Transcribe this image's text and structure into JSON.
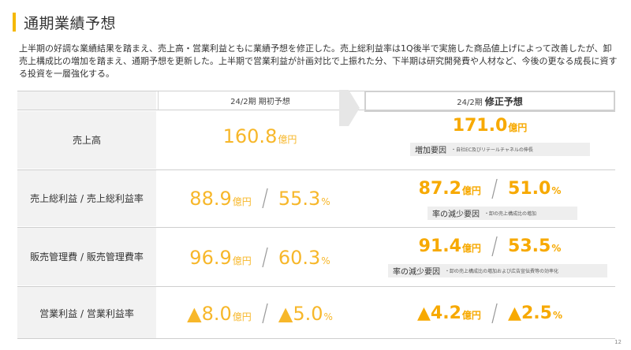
{
  "title": "通期業績予想",
  "description": "上半期の好調な業績結果を踏まえ、売上高・営業利益ともに業績予想を修正した。売上総利益率は1Q後半で実施した商品値上げによって改善したが、卸売上構成比の増加を踏まえ、通期予想を更新した。上半期で営業利益が計画対比で上振れた分、下半期は研究開発費や人材など、今後の更なる成長に資する投資を一層強化する。",
  "header": {
    "original_label": "24/2期 期初予想",
    "revised_prefix": "24/2期",
    "revised_label": "修正予想"
  },
  "rows": [
    {
      "label": "売上高",
      "orig": [
        {
          "v": "160.8",
          "u": "億円"
        }
      ],
      "mod": [
        {
          "v": "171.0",
          "u": "億円"
        }
      ],
      "note_title": "増加要因",
      "note_sub": "・自社EC及びリテールチャネルの伸長"
    },
    {
      "label": "売上総利益 / 売上総利益率",
      "orig": [
        {
          "v": "88.9",
          "u": "億円"
        },
        {
          "v": "55.3",
          "u": "%"
        }
      ],
      "mod": [
        {
          "v": "87.2",
          "u": "億円"
        },
        {
          "v": "51.0",
          "u": "%"
        }
      ],
      "note_title": "率の減少要因",
      "note_sub": "・卸の売上構成比の増加"
    },
    {
      "label": "販売管理費 / 販売管理費率",
      "orig": [
        {
          "v": "96.9",
          "u": "億円"
        },
        {
          "v": "60.3",
          "u": "%"
        }
      ],
      "mod": [
        {
          "v": "91.4",
          "u": "億円"
        },
        {
          "v": "53.5",
          "u": "%"
        }
      ],
      "note_title": "率の減少要因",
      "note_sub": "・卸の売上構成比の増加および広告宣伝費等の効率化"
    },
    {
      "label": "営業利益 / 営業利益率",
      "orig": [
        {
          "v": "▲8.0",
          "u": "億円"
        },
        {
          "v": "▲5.0",
          "u": "%"
        }
      ],
      "mod": [
        {
          "v": "▲4.2",
          "u": "億円"
        },
        {
          "v": "▲2.5",
          "u": "%"
        }
      ]
    }
  ],
  "page_number": "12",
  "colors": {
    "accent": "#f5b800",
    "value": "#f7b72a",
    "label_bg": "#f2f2f2"
  }
}
